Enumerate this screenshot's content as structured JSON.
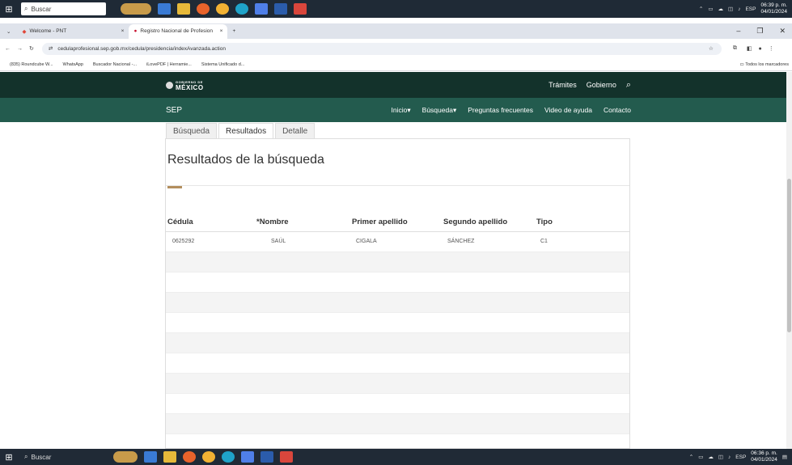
{
  "taskbar": {
    "search_label": "Buscar",
    "lang": "ESP",
    "top_time": "06:39 p. m.",
    "top_date": "04/01/2024",
    "bottom_time": "06:36 p. m.",
    "bottom_date": "04/01/2024"
  },
  "browser": {
    "tabs": [
      {
        "label": "Welcome - PNT"
      },
      {
        "label": "Registro Nacional de Profesion"
      }
    ],
    "url": "cedulaprofesional.sep.gob.mx/cedula/presidencia/indexAvanzada.action",
    "bookmarks": [
      "(835) Roundcube W...",
      "WhatsApp",
      "Buscador Nacional -...",
      "iLovePDF | Herramie...",
      "Sistema Unificado d..."
    ],
    "all_bookmarks": "Todos los marcadores"
  },
  "gov": {
    "logo_small": "GOBIERNO DE",
    "logo_big": "MÉXICO",
    "top_links": [
      "Trámites",
      "Gobierno"
    ],
    "section": "SEP",
    "menu": [
      "Inicio▾",
      "Búsqueda▾",
      "Preguntas frecuentes",
      "Video de ayuda",
      "Contacto"
    ]
  },
  "page": {
    "tabs": [
      "Búsqueda",
      "Resultados",
      "Detalle"
    ],
    "title": "Resultados de la búsqueda",
    "table": {
      "headers": [
        "Cédula",
        "*Nombre",
        "Primer apellido",
        "Segundo apellido",
        "Tipo"
      ],
      "rows": [
        [
          "0625292",
          "SAÚL",
          "CIGALA",
          "SÁNCHEZ",
          "C1"
        ]
      ]
    }
  }
}
